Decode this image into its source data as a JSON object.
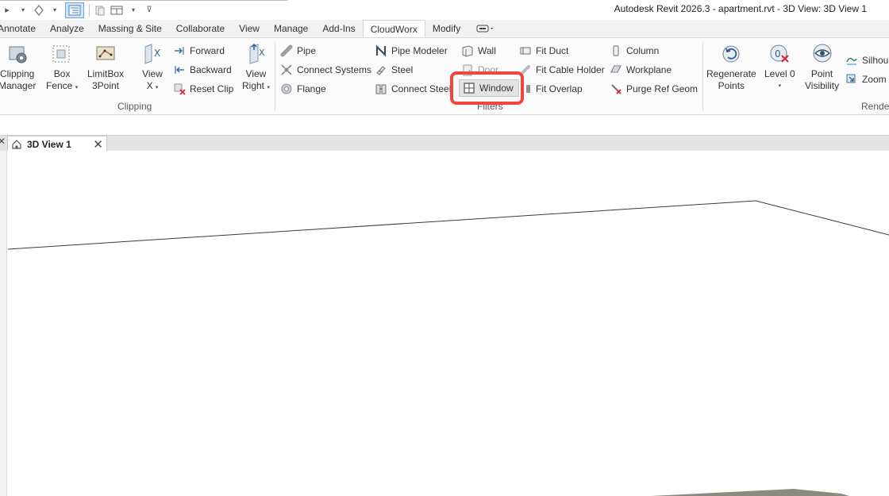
{
  "title_bar": {
    "app_title": "Autodesk Revit 2026.3 - apartment.rvt - 3D View: 3D View 1"
  },
  "tabs": [
    {
      "label": "Annotate"
    },
    {
      "label": "Analyze"
    },
    {
      "label": "Massing & Site"
    },
    {
      "label": "Collaborate"
    },
    {
      "label": "View"
    },
    {
      "label": "Manage"
    },
    {
      "label": "Add-Ins"
    },
    {
      "label": "CloudWorx",
      "active": true
    },
    {
      "label": "Modify"
    }
  ],
  "clipping": {
    "panel_title": "Clipping",
    "clipping_manager": {
      "line1": "Clipping",
      "line2": "Manager"
    },
    "box_fence": {
      "line1": "Box",
      "line2": "Fence"
    },
    "limitbox": {
      "line1": "LimitBox",
      "line2": "3Point"
    },
    "view_x": {
      "line1": "View",
      "line2": "X"
    },
    "forward": "Forward",
    "backward": "Backward",
    "reset_clip": "Reset Clip",
    "view_right": {
      "line1": "View",
      "line2": "Right"
    }
  },
  "modeling": {
    "pipe": "Pipe",
    "connect_systems": "Connect  Systems",
    "flange": "Flange",
    "pipe_modeler": "Pipe Modeler",
    "steel": "Steel",
    "connect_steel": "Connect  Steel"
  },
  "filters": {
    "panel_title": "Filters",
    "wall": "Wall",
    "door": "Door",
    "window": "Window"
  },
  "fit": {
    "fit_duct": "Fit Duct",
    "fit_cable_holder": "Fit Cable Holder",
    "fit_overlap": "Fit Overlap",
    "column": "Column",
    "workplane": "Workplane",
    "purge_ref_geom": "Purge  Ref Geom"
  },
  "render": {
    "panel_title": "Rende",
    "regenerate": {
      "line1": "Regenerate",
      "line2": "Points"
    },
    "level0": {
      "line1": "Level 0"
    },
    "point_visibility": {
      "line1": "Point",
      "line2": "Visibility"
    },
    "silhouette": "Silhoue",
    "zoom": "Zoom"
  },
  "view_tab": {
    "label": "3D View 1"
  },
  "colors": {
    "highlight": "#f0473b",
    "active_tab_bg": "#ffffff",
    "ribbon_bg": "#fbfbfb"
  }
}
